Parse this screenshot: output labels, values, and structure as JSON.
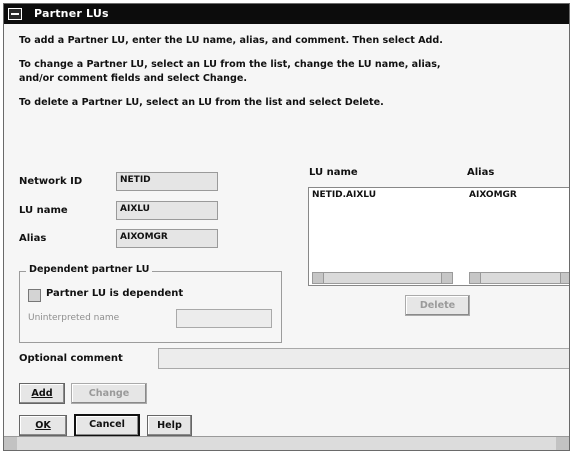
{
  "window": {
    "title": "Partner LUs"
  },
  "instructions": [
    "To add a Partner LU, enter the LU name, alias, and comment.  Then select Add.",
    "To change a Partner LU, select an LU from the list, change the LU name, alias,",
    "and/or comment fields and select Change.",
    "To delete a Partner LU, select an LU from the list and select Delete."
  ],
  "fields": {
    "network_id": {
      "label": "Network ID",
      "value": "NETID"
    },
    "lu_name": {
      "label": "LU name",
      "value": "AIXLU"
    },
    "alias": {
      "label": "Alias",
      "value": "AIXOMGR"
    }
  },
  "dependent_group": {
    "label": "Dependent partner LU",
    "checkbox_label": "Partner LU is dependent",
    "uninterpreted_label": "Uninterpreted name",
    "uninterpreted_value": ""
  },
  "list": {
    "columns": [
      "LU name",
      "Alias"
    ],
    "rows": [
      {
        "lu_name": "NETID.AIXLU",
        "alias": "AIXOMGR"
      }
    ]
  },
  "buttons": {
    "delete": "Delete",
    "add": "Add",
    "change": "Change",
    "ok": "OK",
    "cancel": "Cancel",
    "help": "Help"
  },
  "comment": {
    "label": "Optional comment",
    "value": ""
  }
}
